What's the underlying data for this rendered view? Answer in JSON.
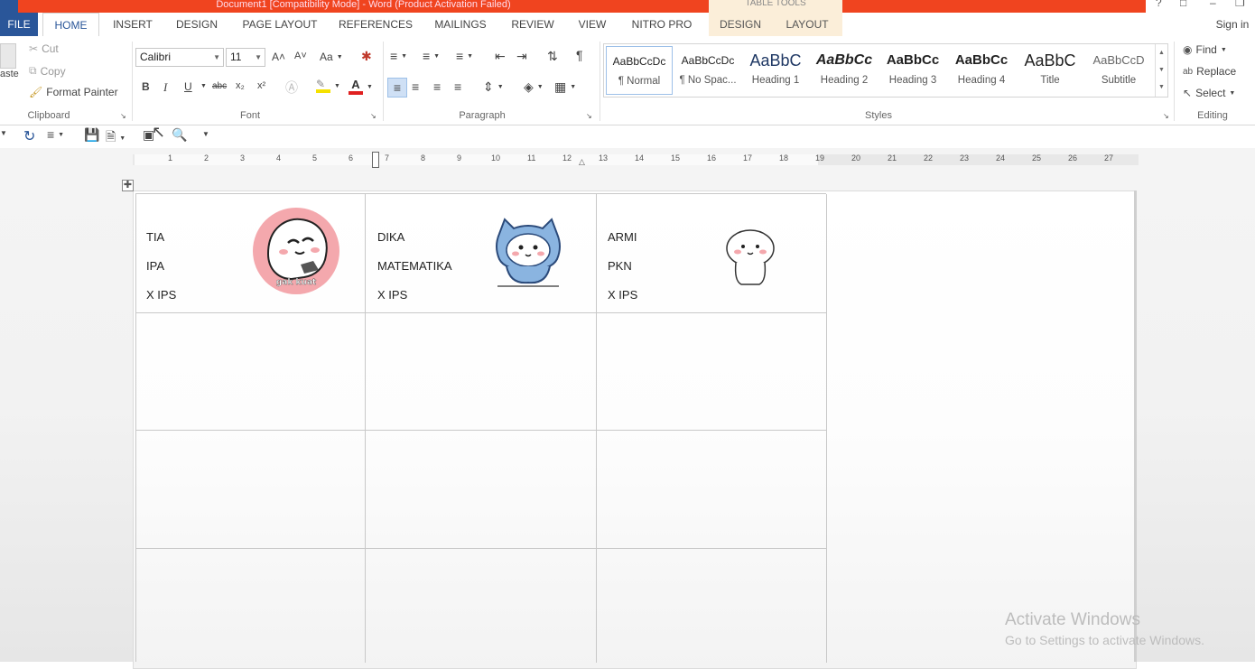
{
  "window": {
    "title": "Document1 [Compatibility Mode] - Word (Product Activation Failed)",
    "context_group": "TABLE TOOLS",
    "sign_in": "Sign in"
  },
  "tabs": [
    {
      "label": "FILE"
    },
    {
      "label": "HOME"
    },
    {
      "label": "INSERT"
    },
    {
      "label": "DESIGN"
    },
    {
      "label": "PAGE LAYOUT"
    },
    {
      "label": "REFERENCES"
    },
    {
      "label": "MAILINGS"
    },
    {
      "label": "REVIEW"
    },
    {
      "label": "VIEW"
    },
    {
      "label": "NITRO PRO"
    },
    {
      "label": "DESIGN"
    },
    {
      "label": "LAYOUT"
    }
  ],
  "clipboard": {
    "paste": "aste",
    "cut": "Cut",
    "copy": "Copy",
    "format_painter": "Format Painter",
    "label": "Clipboard"
  },
  "font": {
    "name": "Calibri",
    "size": "11",
    "change_case": "Aa",
    "label": "Font",
    "bold": "B",
    "italic": "I",
    "underline": "U",
    "strike": "abc",
    "sub": "x₂",
    "sup": "x²",
    "grow": "A˄",
    "shrink": "A˅",
    "color_a": "A",
    "highlight_color": "#f5e100",
    "font_color": "#e02020"
  },
  "paragraph": {
    "label": "Paragraph"
  },
  "styles": {
    "label": "Styles",
    "items": [
      {
        "preview": "AaBbCcDc",
        "name": "¶ Normal"
      },
      {
        "preview": "AaBbCcDc",
        "name": "¶ No Spac..."
      },
      {
        "preview": "AaBbC",
        "name": "Heading 1"
      },
      {
        "preview": "AaBbCc",
        "name": "Heading 2"
      },
      {
        "preview": "AaBbCc",
        "name": "Heading 3"
      },
      {
        "preview": "AaBbCc",
        "name": "Heading 4"
      },
      {
        "preview": "AaBbC",
        "name": "Title"
      },
      {
        "preview": "AaBbCcD",
        "name": "Subtitle"
      }
    ]
  },
  "editing": {
    "find": "Find",
    "replace": "Replace",
    "select": "Select",
    "label": "Editing"
  },
  "ruler": {
    "numbers": [
      "1",
      "2",
      "3",
      "4",
      "5",
      "6",
      "7",
      "8",
      "9",
      "10",
      "11",
      "12",
      "13",
      "14",
      "15",
      "16",
      "17",
      "18",
      "19",
      "20",
      "21",
      "22",
      "23",
      "24",
      "25",
      "26",
      "27"
    ]
  },
  "table": {
    "rows": [
      [
        {
          "lines": [
            "TIA",
            "IPA",
            "X IPS"
          ],
          "sticker": "Ghost sticker",
          "sticker_caption": "gak kuat"
        },
        {
          "lines": [
            "DIKA",
            "MATEMATIKA",
            "X IPS"
          ],
          "sticker": "Blue cat hood sticker"
        },
        {
          "lines": [
            "ARMI",
            "PKN",
            "X IPS"
          ],
          "sticker": "Small ghost sticker"
        }
      ],
      [
        {
          "lines": []
        },
        {
          "lines": []
        },
        {
          "lines": []
        }
      ],
      [
        {
          "lines": []
        },
        {
          "lines": []
        },
        {
          "lines": []
        }
      ],
      [
        {
          "lines": []
        },
        {
          "lines": []
        },
        {
          "lines": []
        }
      ]
    ]
  },
  "watermark": {
    "line1": "Activate Windows",
    "line2": "Go to Settings to activate Windows."
  }
}
